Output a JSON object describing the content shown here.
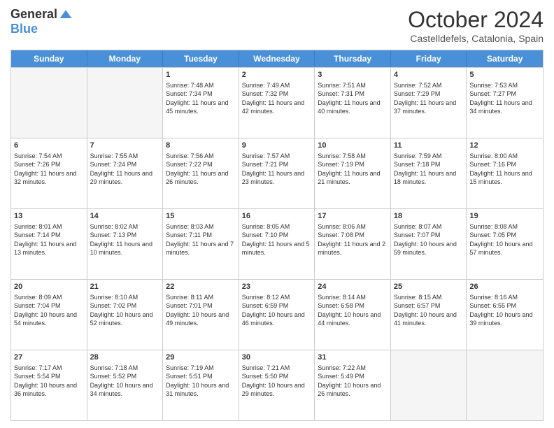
{
  "logo": {
    "general": "General",
    "blue": "Blue"
  },
  "title": "October 2024",
  "location": "Castelldefels, Catalonia, Spain",
  "days": [
    "Sunday",
    "Monday",
    "Tuesday",
    "Wednesday",
    "Thursday",
    "Friday",
    "Saturday"
  ],
  "weeks": [
    [
      {
        "day": "",
        "sunrise": "",
        "sunset": "",
        "daylight": "",
        "empty": true
      },
      {
        "day": "",
        "sunrise": "",
        "sunset": "",
        "daylight": "",
        "empty": true
      },
      {
        "day": "1",
        "sunrise": "Sunrise: 7:48 AM",
        "sunset": "Sunset: 7:34 PM",
        "daylight": "Daylight: 11 hours and 45 minutes.",
        "empty": false
      },
      {
        "day": "2",
        "sunrise": "Sunrise: 7:49 AM",
        "sunset": "Sunset: 7:32 PM",
        "daylight": "Daylight: 11 hours and 42 minutes.",
        "empty": false
      },
      {
        "day": "3",
        "sunrise": "Sunrise: 7:51 AM",
        "sunset": "Sunset: 7:31 PM",
        "daylight": "Daylight: 11 hours and 40 minutes.",
        "empty": false
      },
      {
        "day": "4",
        "sunrise": "Sunrise: 7:52 AM",
        "sunset": "Sunset: 7:29 PM",
        "daylight": "Daylight: 11 hours and 37 minutes.",
        "empty": false
      },
      {
        "day": "5",
        "sunrise": "Sunrise: 7:53 AM",
        "sunset": "Sunset: 7:27 PM",
        "daylight": "Daylight: 11 hours and 34 minutes.",
        "empty": false
      }
    ],
    [
      {
        "day": "6",
        "sunrise": "Sunrise: 7:54 AM",
        "sunset": "Sunset: 7:26 PM",
        "daylight": "Daylight: 11 hours and 32 minutes.",
        "empty": false
      },
      {
        "day": "7",
        "sunrise": "Sunrise: 7:55 AM",
        "sunset": "Sunset: 7:24 PM",
        "daylight": "Daylight: 11 hours and 29 minutes.",
        "empty": false
      },
      {
        "day": "8",
        "sunrise": "Sunrise: 7:56 AM",
        "sunset": "Sunset: 7:22 PM",
        "daylight": "Daylight: 11 hours and 26 minutes.",
        "empty": false
      },
      {
        "day": "9",
        "sunrise": "Sunrise: 7:57 AM",
        "sunset": "Sunset: 7:21 PM",
        "daylight": "Daylight: 11 hours and 23 minutes.",
        "empty": false
      },
      {
        "day": "10",
        "sunrise": "Sunrise: 7:58 AM",
        "sunset": "Sunset: 7:19 PM",
        "daylight": "Daylight: 11 hours and 21 minutes.",
        "empty": false
      },
      {
        "day": "11",
        "sunrise": "Sunrise: 7:59 AM",
        "sunset": "Sunset: 7:18 PM",
        "daylight": "Daylight: 11 hours and 18 minutes.",
        "empty": false
      },
      {
        "day": "12",
        "sunrise": "Sunrise: 8:00 AM",
        "sunset": "Sunset: 7:16 PM",
        "daylight": "Daylight: 11 hours and 15 minutes.",
        "empty": false
      }
    ],
    [
      {
        "day": "13",
        "sunrise": "Sunrise: 8:01 AM",
        "sunset": "Sunset: 7:14 PM",
        "daylight": "Daylight: 11 hours and 13 minutes.",
        "empty": false
      },
      {
        "day": "14",
        "sunrise": "Sunrise: 8:02 AM",
        "sunset": "Sunset: 7:13 PM",
        "daylight": "Daylight: 11 hours and 10 minutes.",
        "empty": false
      },
      {
        "day": "15",
        "sunrise": "Sunrise: 8:03 AM",
        "sunset": "Sunset: 7:11 PM",
        "daylight": "Daylight: 11 hours and 7 minutes.",
        "empty": false
      },
      {
        "day": "16",
        "sunrise": "Sunrise: 8:05 AM",
        "sunset": "Sunset: 7:10 PM",
        "daylight": "Daylight: 11 hours and 5 minutes.",
        "empty": false
      },
      {
        "day": "17",
        "sunrise": "Sunrise: 8:06 AM",
        "sunset": "Sunset: 7:08 PM",
        "daylight": "Daylight: 11 hours and 2 minutes.",
        "empty": false
      },
      {
        "day": "18",
        "sunrise": "Sunrise: 8:07 AM",
        "sunset": "Sunset: 7:07 PM",
        "daylight": "Daylight: 10 hours and 59 minutes.",
        "empty": false
      },
      {
        "day": "19",
        "sunrise": "Sunrise: 8:08 AM",
        "sunset": "Sunset: 7:05 PM",
        "daylight": "Daylight: 10 hours and 57 minutes.",
        "empty": false
      }
    ],
    [
      {
        "day": "20",
        "sunrise": "Sunrise: 8:09 AM",
        "sunset": "Sunset: 7:04 PM",
        "daylight": "Daylight: 10 hours and 54 minutes.",
        "empty": false
      },
      {
        "day": "21",
        "sunrise": "Sunrise: 8:10 AM",
        "sunset": "Sunset: 7:02 PM",
        "daylight": "Daylight: 10 hours and 52 minutes.",
        "empty": false
      },
      {
        "day": "22",
        "sunrise": "Sunrise: 8:11 AM",
        "sunset": "Sunset: 7:01 PM",
        "daylight": "Daylight: 10 hours and 49 minutes.",
        "empty": false
      },
      {
        "day": "23",
        "sunrise": "Sunrise: 8:12 AM",
        "sunset": "Sunset: 6:59 PM",
        "daylight": "Daylight: 10 hours and 46 minutes.",
        "empty": false
      },
      {
        "day": "24",
        "sunrise": "Sunrise: 8:14 AM",
        "sunset": "Sunset: 6:58 PM",
        "daylight": "Daylight: 10 hours and 44 minutes.",
        "empty": false
      },
      {
        "day": "25",
        "sunrise": "Sunrise: 8:15 AM",
        "sunset": "Sunset: 6:57 PM",
        "daylight": "Daylight: 10 hours and 41 minutes.",
        "empty": false
      },
      {
        "day": "26",
        "sunrise": "Sunrise: 8:16 AM",
        "sunset": "Sunset: 6:55 PM",
        "daylight": "Daylight: 10 hours and 39 minutes.",
        "empty": false
      }
    ],
    [
      {
        "day": "27",
        "sunrise": "Sunrise: 7:17 AM",
        "sunset": "Sunset: 5:54 PM",
        "daylight": "Daylight: 10 hours and 36 minutes.",
        "empty": false
      },
      {
        "day": "28",
        "sunrise": "Sunrise: 7:18 AM",
        "sunset": "Sunset: 5:52 PM",
        "daylight": "Daylight: 10 hours and 34 minutes.",
        "empty": false
      },
      {
        "day": "29",
        "sunrise": "Sunrise: 7:19 AM",
        "sunset": "Sunset: 5:51 PM",
        "daylight": "Daylight: 10 hours and 31 minutes.",
        "empty": false
      },
      {
        "day": "30",
        "sunrise": "Sunrise: 7:21 AM",
        "sunset": "Sunset: 5:50 PM",
        "daylight": "Daylight: 10 hours and 29 minutes.",
        "empty": false
      },
      {
        "day": "31",
        "sunrise": "Sunrise: 7:22 AM",
        "sunset": "Sunset: 5:49 PM",
        "daylight": "Daylight: 10 hours and 26 minutes.",
        "empty": false
      },
      {
        "day": "",
        "sunrise": "",
        "sunset": "",
        "daylight": "",
        "empty": true
      },
      {
        "day": "",
        "sunrise": "",
        "sunset": "",
        "daylight": "",
        "empty": true
      }
    ]
  ]
}
